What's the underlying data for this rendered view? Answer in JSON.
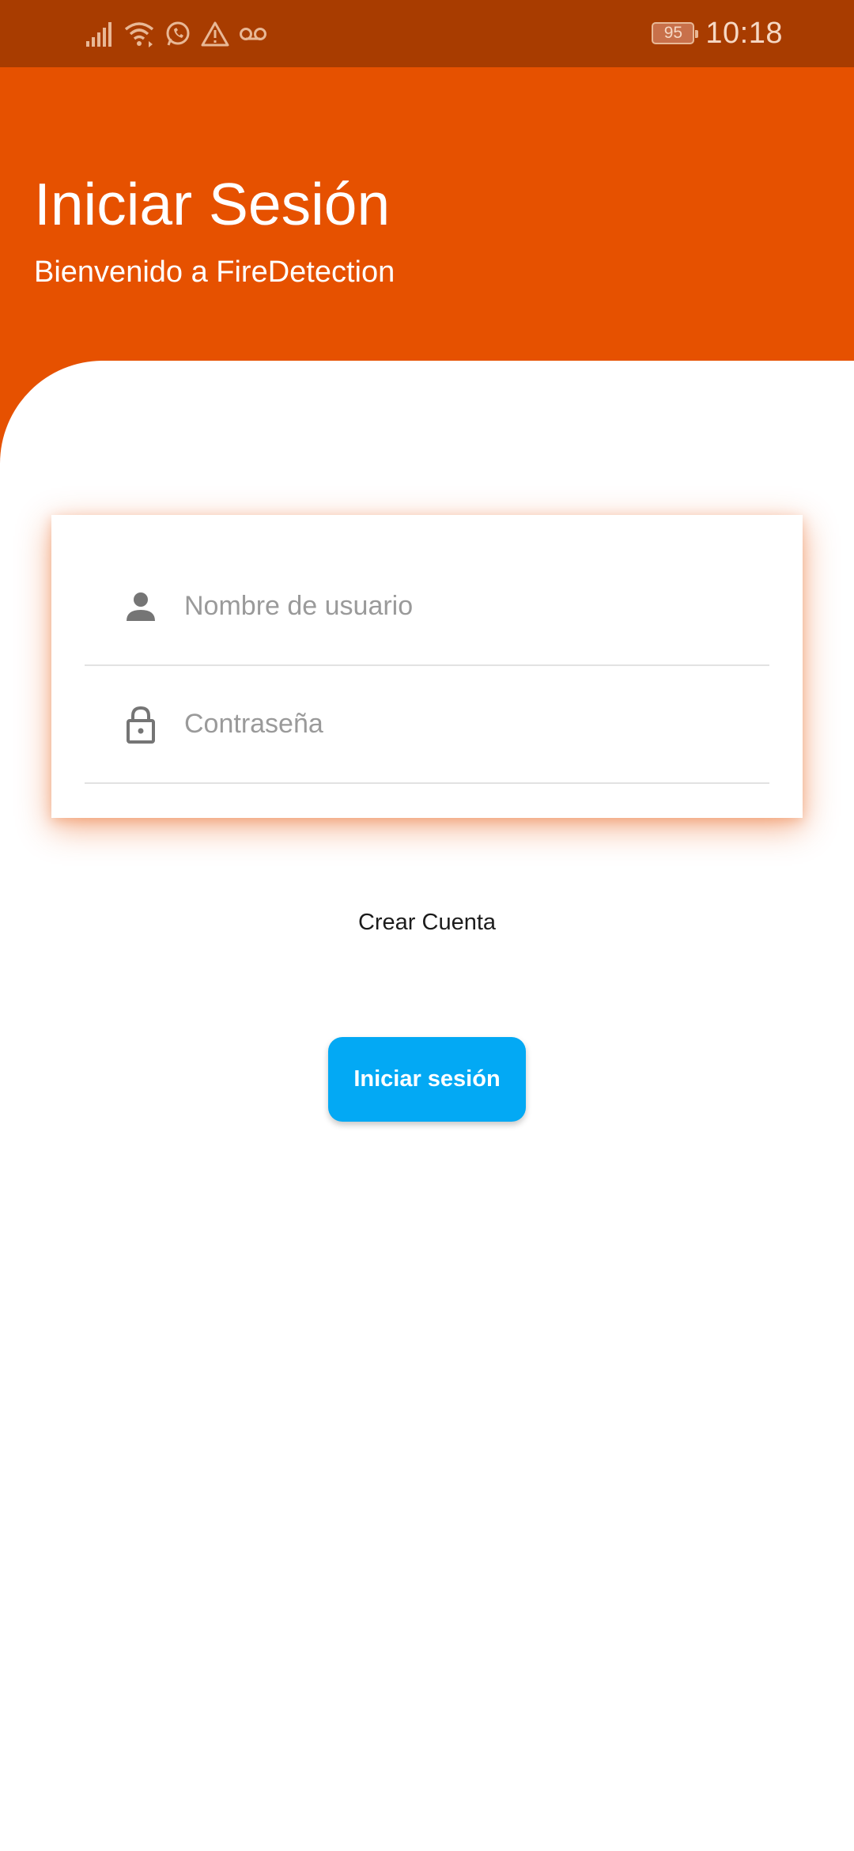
{
  "status_bar": {
    "icons": [
      "signal-icon",
      "wifi-icon",
      "whatsapp-icon",
      "warning-icon",
      "voicemail-icon"
    ],
    "battery_level": "95",
    "time": "10:18"
  },
  "header": {
    "title": "Iniciar Sesión",
    "subtitle": "Bienvenido a FireDetection",
    "background_color": "#e65100"
  },
  "login_form": {
    "username": {
      "icon": "person-icon",
      "value": "",
      "placeholder": "Nombre de usuario"
    },
    "password": {
      "icon": "lock-icon",
      "value": "",
      "placeholder": "Contraseña"
    }
  },
  "create_account_label": "Crear Cuenta",
  "login_button": {
    "label": "Iniciar sesión",
    "color": "#03a9f4"
  }
}
